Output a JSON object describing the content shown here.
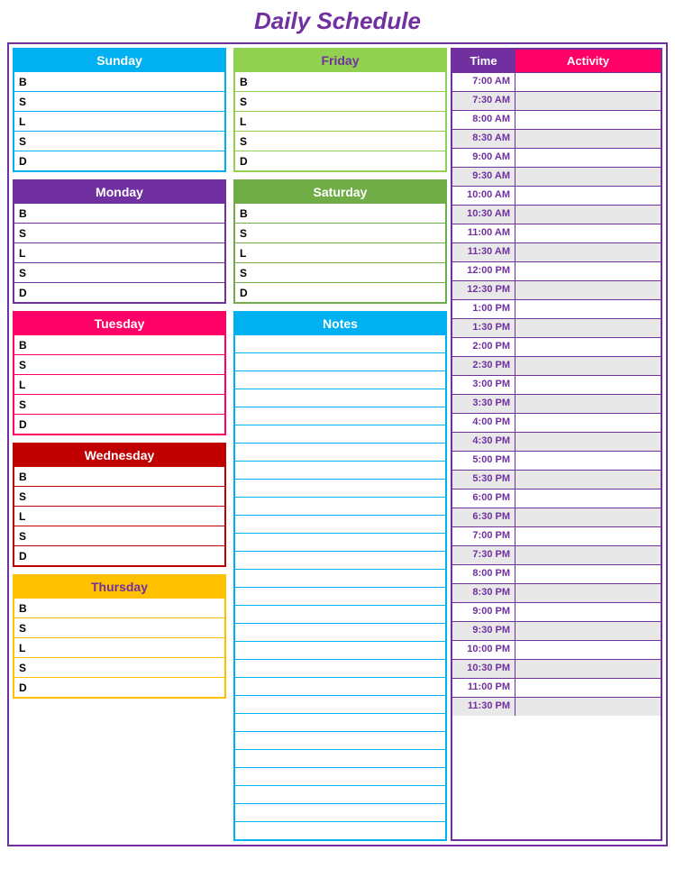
{
  "title": "Daily Schedule",
  "days": {
    "sunday": {
      "label": "Sunday",
      "class": "sunday",
      "meals": [
        "B",
        "S",
        "L",
        "S",
        "D"
      ]
    },
    "monday": {
      "label": "Monday",
      "class": "monday",
      "meals": [
        "B",
        "S",
        "L",
        "S",
        "D"
      ]
    },
    "tuesday": {
      "label": "Tuesday",
      "class": "tuesday",
      "meals": [
        "B",
        "S",
        "L",
        "S",
        "D"
      ]
    },
    "wednesday": {
      "label": "Wednesday",
      "class": "wednesday",
      "meals": [
        "B",
        "S",
        "L",
        "S",
        "D"
      ]
    },
    "thursday": {
      "label": "Thursday",
      "class": "thursday",
      "meals": [
        "B",
        "S",
        "L",
        "S",
        "D"
      ]
    },
    "friday": {
      "label": "Friday",
      "class": "friday",
      "meals": [
        "B",
        "S",
        "L",
        "S",
        "D"
      ]
    },
    "saturday": {
      "label": "Saturday",
      "class": "saturday",
      "meals": [
        "B",
        "S",
        "L",
        "S",
        "D"
      ]
    }
  },
  "notes": {
    "label": "Notes",
    "lines": 28
  },
  "schedule": {
    "headers": {
      "time": "Time",
      "activity": "Activity"
    },
    "slots": [
      "7:00 AM",
      "7:30 AM",
      "8:00 AM",
      "8:30 AM",
      "9:00 AM",
      "9:30 AM",
      "10:00 AM",
      "10:30 AM",
      "11:00 AM",
      "11:30 AM",
      "12:00 PM",
      "12:30 PM",
      "1:00 PM",
      "1:30 PM",
      "2:00 PM",
      "2:30 PM",
      "3:00 PM",
      "3:30 PM",
      "4:00 PM",
      "4:30 PM",
      "5:00 PM",
      "5:30 PM",
      "6:00 PM",
      "6:30 PM",
      "7:00 PM",
      "7:30 PM",
      "8:00 PM",
      "8:30 PM",
      "9:00 PM",
      "9:30 PM",
      "10:00 PM",
      "10:30 PM",
      "11:00 PM",
      "11:30 PM"
    ]
  }
}
